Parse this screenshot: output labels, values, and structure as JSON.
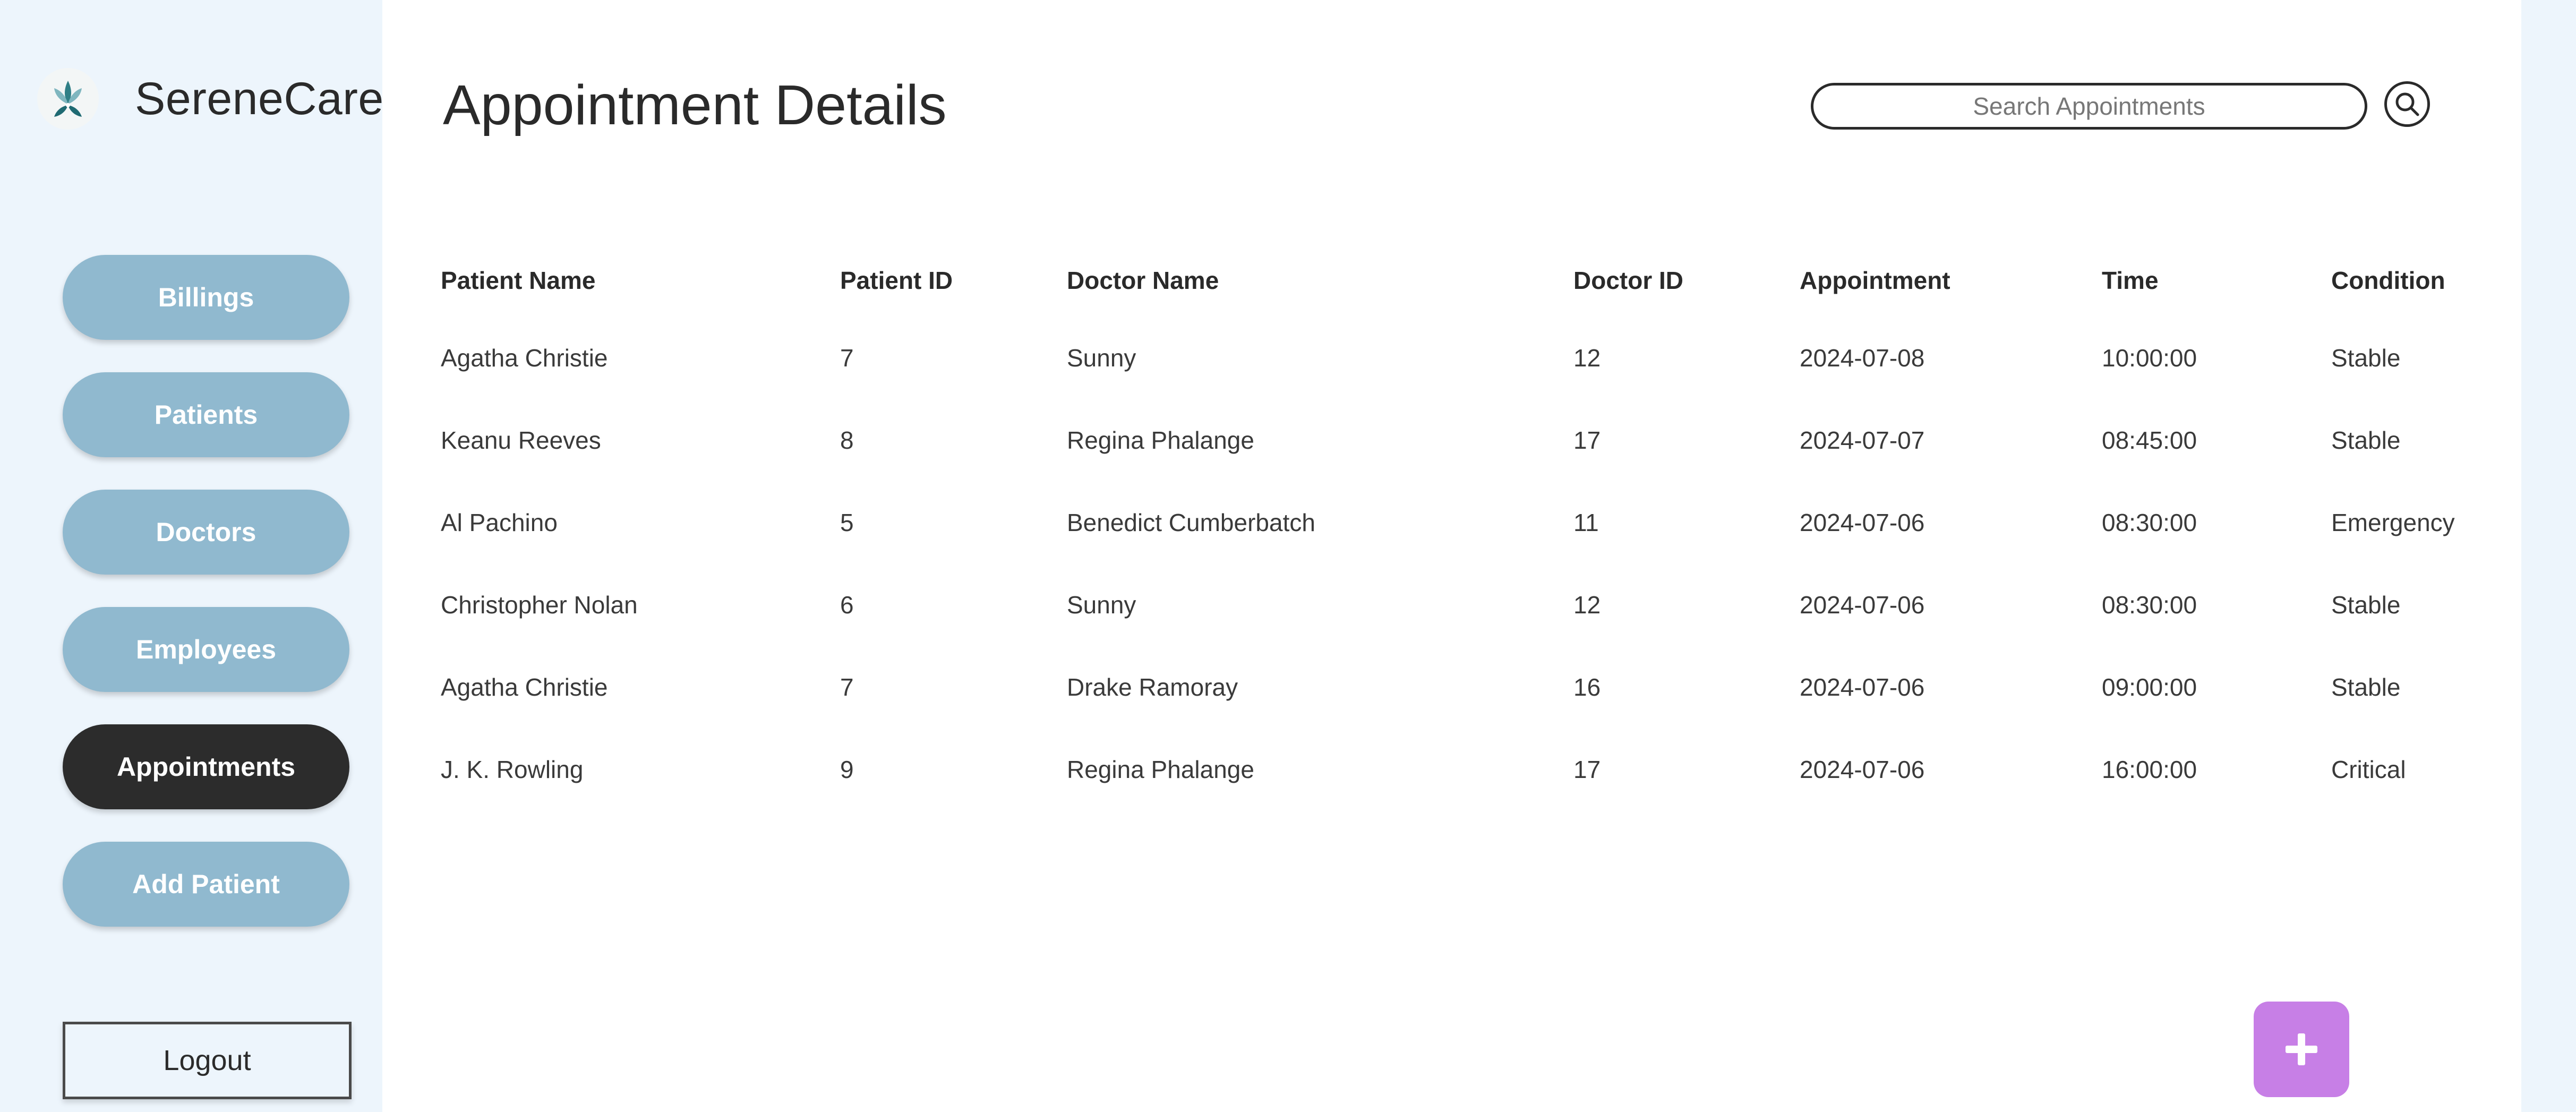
{
  "brand": {
    "name": "SereneCare"
  },
  "nav": {
    "items": [
      {
        "label": "Billings"
      },
      {
        "label": "Patients"
      },
      {
        "label": "Doctors"
      },
      {
        "label": "Employees"
      },
      {
        "label": "Appointments"
      },
      {
        "label": "Add Patient"
      }
    ],
    "active": "Appointments",
    "logout_label": "Logout"
  },
  "page": {
    "title": "Appointment Details"
  },
  "search": {
    "placeholder": "Search Appointments",
    "value": ""
  },
  "table": {
    "columns": [
      "Patient Name",
      "Patient ID",
      "Doctor Name",
      "Doctor ID",
      "Appointment",
      "Time",
      "Condition"
    ],
    "rows": [
      [
        "Agatha Christie",
        "7",
        "Sunny",
        "12",
        "2024-07-08",
        "10:00:00",
        "Stable"
      ],
      [
        "Keanu Reeves",
        "8",
        "Regina Phalange",
        "17",
        "2024-07-07",
        "08:45:00",
        "Stable"
      ],
      [
        "Al Pachino",
        "5",
        "Benedict Cumberbatch",
        "11",
        "2024-07-06",
        "08:30:00",
        "Emergency"
      ],
      [
        "Christopher Nolan",
        "6",
        "Sunny",
        "12",
        "2024-07-06",
        "08:30:00",
        "Stable"
      ],
      [
        "Agatha Christie",
        "7",
        "Drake Ramoray",
        "16",
        "2024-07-06",
        "09:00:00",
        "Stable"
      ],
      [
        "J. K. Rowling",
        "9",
        "Regina Phalange",
        "17",
        "2024-07-06",
        "16:00:00",
        "Critical"
      ]
    ]
  },
  "icons": {
    "logo": "serenecare-logo-icon",
    "search": "search-icon",
    "add": "plus-icon"
  },
  "colors": {
    "sidebar_bg": "#edf5fc",
    "nav_button": "#90b9cf",
    "nav_active": "#2c2c2c",
    "fab": "#c77fe6"
  }
}
